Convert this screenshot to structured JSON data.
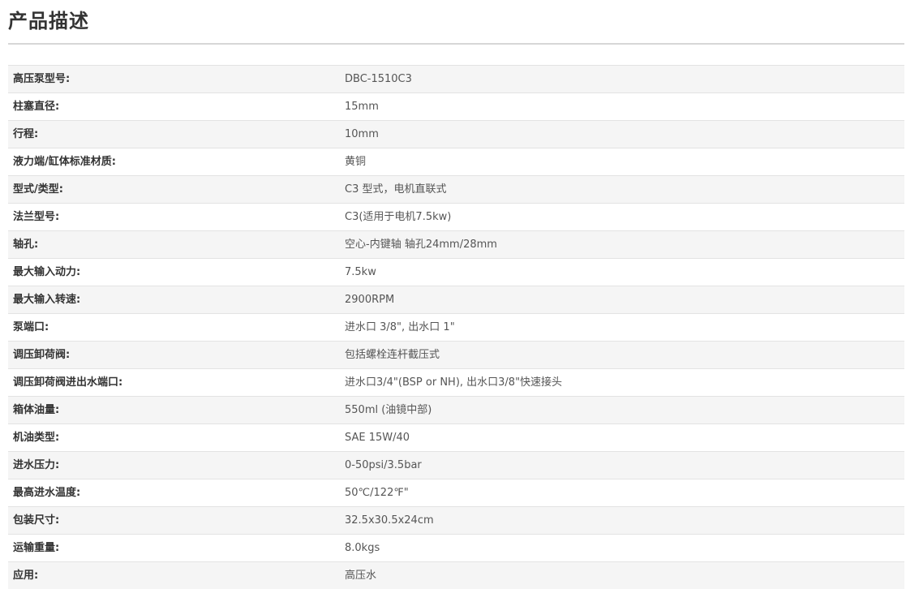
{
  "page": {
    "title": "产品描述"
  },
  "specs": [
    {
      "label": "高压泵型号:",
      "value": "DBC-1510C3"
    },
    {
      "label": "柱塞直径:",
      "value": "15mm"
    },
    {
      "label": "行程:",
      "value": "10mm"
    },
    {
      "label": "液力端/缸体标准材质:",
      "value": "黄铜"
    },
    {
      "label": "型式/类型:",
      "value": "C3 型式，电机直联式"
    },
    {
      "label": "法兰型号:",
      "value": "C3(适用于电机7.5kw)"
    },
    {
      "label": "轴孔:",
      "value": "空心-内键轴  轴孔24mm/28mm"
    },
    {
      "label": "最大输入动力:",
      "value": "7.5kw"
    },
    {
      "label": "最大输入转速:",
      "value": "2900RPM"
    },
    {
      "label": "泵端口:",
      "value": "进水口 3/8\", 出水口 1\""
    },
    {
      "label": "调压卸荷阀:",
      "value": "包括螺栓连杆截压式"
    },
    {
      "label": "调压卸荷阀进出水端口:",
      "value": "进水口3/4\"(BSP or NH), 出水口3/8\"快速接头"
    },
    {
      "label": "箱体油量:",
      "value": "550ml (油镜中部)"
    },
    {
      "label": "机油类型:",
      "value": "SAE 15W/40"
    },
    {
      "label": "进水压力:",
      "value": "0-50psi/3.5bar"
    },
    {
      "label": "最高进水温度:",
      "value": "50℃/122℉\""
    },
    {
      "label": "包装尺寸:",
      "value": "32.5x30.5x24cm"
    },
    {
      "label": "运输重量:",
      "value": "8.0kgs"
    },
    {
      "label": "应用:",
      "value": "高压水"
    }
  ]
}
